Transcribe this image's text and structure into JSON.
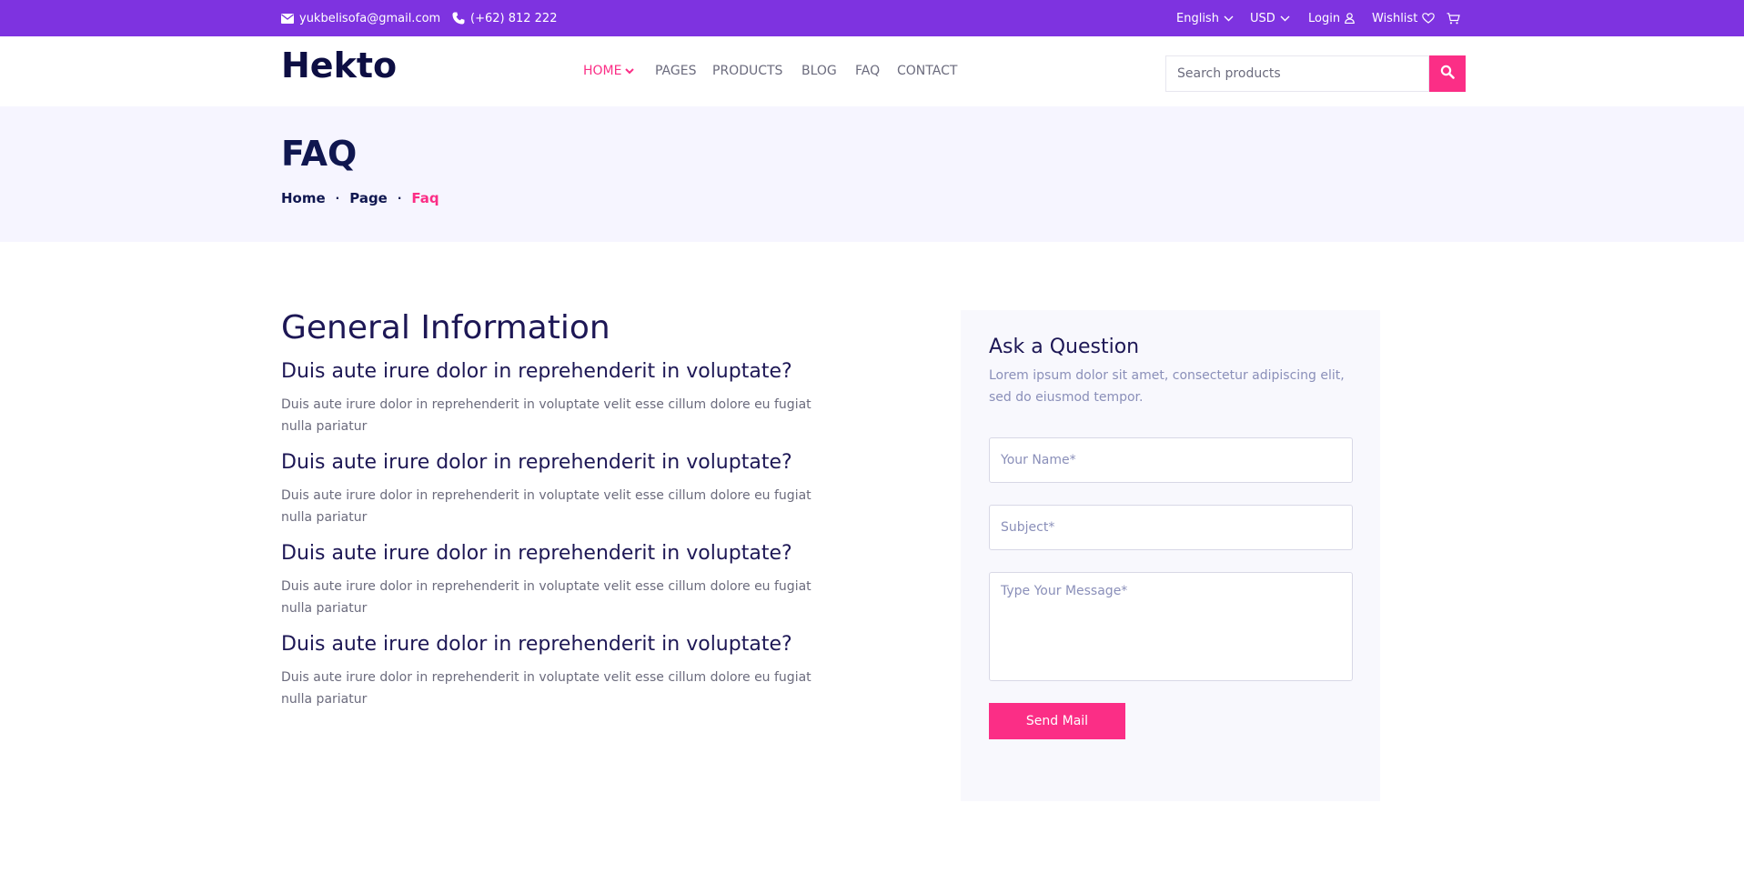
{
  "topbar": {
    "email": "yukbelisofa@gmail.com",
    "phone": "(+62) 812 222",
    "language": "English",
    "currency": "USD",
    "login": "Login",
    "wishlist": "Wishlist",
    "email_icon": "envelope-icon",
    "phone_icon": "phone-icon",
    "user_icon": "user-icon",
    "heart_icon": "heart-icon",
    "cart_icon": "cart-icon"
  },
  "header": {
    "logo": "Hekto",
    "nav": [
      "HOME",
      "PAGES",
      "PRODUCTS",
      "BLOG",
      "FAQ",
      "CONTACT"
    ],
    "search_placeholder": "Search products",
    "search_icon": "search-icon"
  },
  "hero": {
    "title": "FAQ",
    "breadcrumb": [
      "Home",
      "Page",
      "Faq"
    ]
  },
  "faq": {
    "title": "General Information",
    "items": [
      {
        "q": "Duis aute irure dolor in reprehenderit in voluptate?",
        "a": "Duis aute irure dolor in reprehenderit in voluptate velit esse cillum dolore eu fugiat nulla pariatur"
      },
      {
        "q": "Duis aute irure dolor in reprehenderit in voluptate?",
        "a": "Duis aute irure dolor in reprehenderit in voluptate velit esse cillum dolore eu fugiat nulla pariatur"
      },
      {
        "q": "Duis aute irure dolor in reprehenderit in voluptate?",
        "a": "Duis aute irure dolor in reprehenderit in voluptate velit esse cillum dolore eu fugiat nulla pariatur"
      },
      {
        "q": "Duis aute irure dolor in reprehenderit in voluptate?",
        "a": "Duis aute irure dolor in reprehenderit in voluptate velit esse cillum dolore eu fugiat nulla pariatur"
      }
    ]
  },
  "form": {
    "title": "Ask a Question",
    "subtitle": "Lorem ipsum dolor sit amet, consectetur adipiscing elit, sed do eiusmod tempor.",
    "name_placeholder": "Your Name*",
    "subject_placeholder": "Subject*",
    "message_placeholder": "Type Your Message*",
    "submit": "Send Mail"
  },
  "colors": {
    "topbar": "#7E33E0",
    "accent": "#FB2E86",
    "navy": "#101750",
    "hero_bg": "#F6F5FF"
  }
}
